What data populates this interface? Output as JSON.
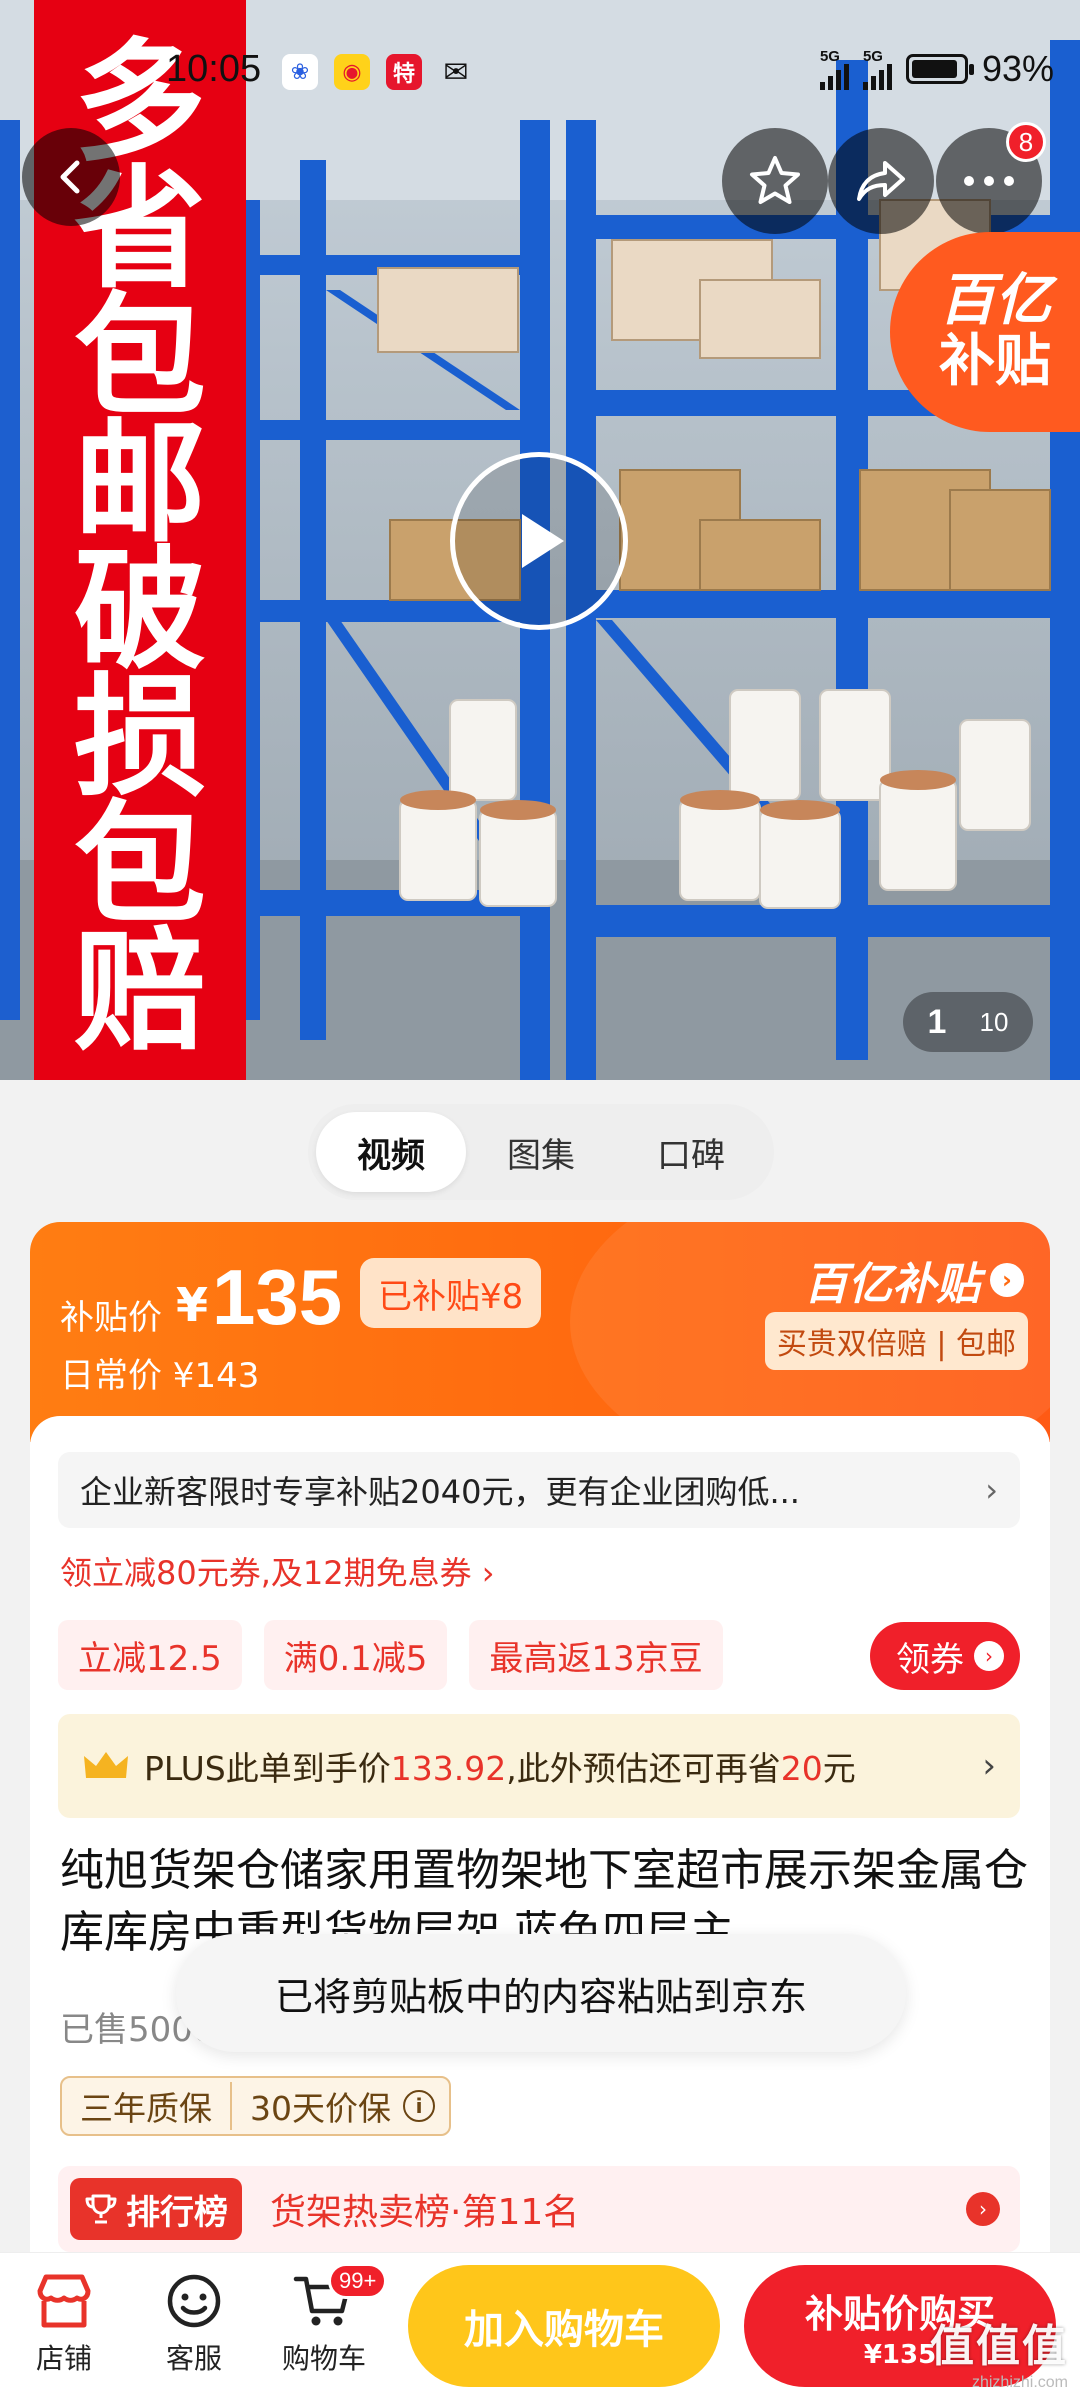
{
  "status_bar": {
    "time": "10:05",
    "apps": [
      "baidu-icon",
      "weibo-icon",
      "temu-icon",
      "wechat-icon"
    ],
    "signal_1": "5G",
    "signal_2": "5G",
    "battery": "93%"
  },
  "hero": {
    "banner_chars": [
      "多",
      "省",
      "包",
      "邮",
      "破",
      "损",
      "包",
      "赔"
    ],
    "notification_count": "8",
    "subsidy_badge_line1": "百亿",
    "subsidy_badge_line2": "补贴",
    "image_index": "1",
    "image_total": "10"
  },
  "media_tabs": [
    {
      "label": "视频",
      "active": true
    },
    {
      "label": "图集",
      "active": false
    },
    {
      "label": "口碑",
      "active": false
    }
  ],
  "price_card": {
    "label": "补贴价",
    "currency": "¥",
    "price": "135",
    "saved": "已补贴¥8",
    "daily_price": "日常价 ¥143",
    "brand": "百亿补贴",
    "tag": "买贵双倍赔 | 包邮"
  },
  "detail": {
    "promo_text": "企业新客限时专享补贴2040元，更有企业团购低...",
    "coupon_line": "领立减80元券,及12期免息券",
    "chips": [
      "立减12.5",
      "满0.1减5",
      "最高返13京豆"
    ],
    "claim_label": "领券",
    "plus_text_a": "PLUS此单到手价",
    "plus_price": "133.92",
    "plus_text_b": ",此外预估还可再省",
    "plus_save": "20",
    "plus_text_c": "元",
    "title": "纯旭货架仓储家用置物架地下室超市展示架金属仓库库房中重型货物层架 蓝色四层主",
    "sold": "已售5000+",
    "toast": "已将剪贴板中的内容粘贴到京东",
    "guarantee_1": "三年质保",
    "guarantee_2": "30天价保",
    "rank_tag": "排行榜",
    "rank_text": "货架热卖榜·第11名"
  },
  "bottom_bar": {
    "store": "店铺",
    "service": "客服",
    "cart": "购物车",
    "cart_badge": "99+",
    "add_to_cart": "加入购物车",
    "buy_label": "补贴价购买",
    "buy_price": "¥135"
  },
  "watermark": {
    "line1": "值值值",
    "line2": "zhizhizhi.com"
  },
  "colors": {
    "jd_red": "#f0202a",
    "subsidy_orange": "#ff6a10",
    "cart_yellow": "#ffc61a",
    "shelf_blue": "#1a5fd0"
  }
}
